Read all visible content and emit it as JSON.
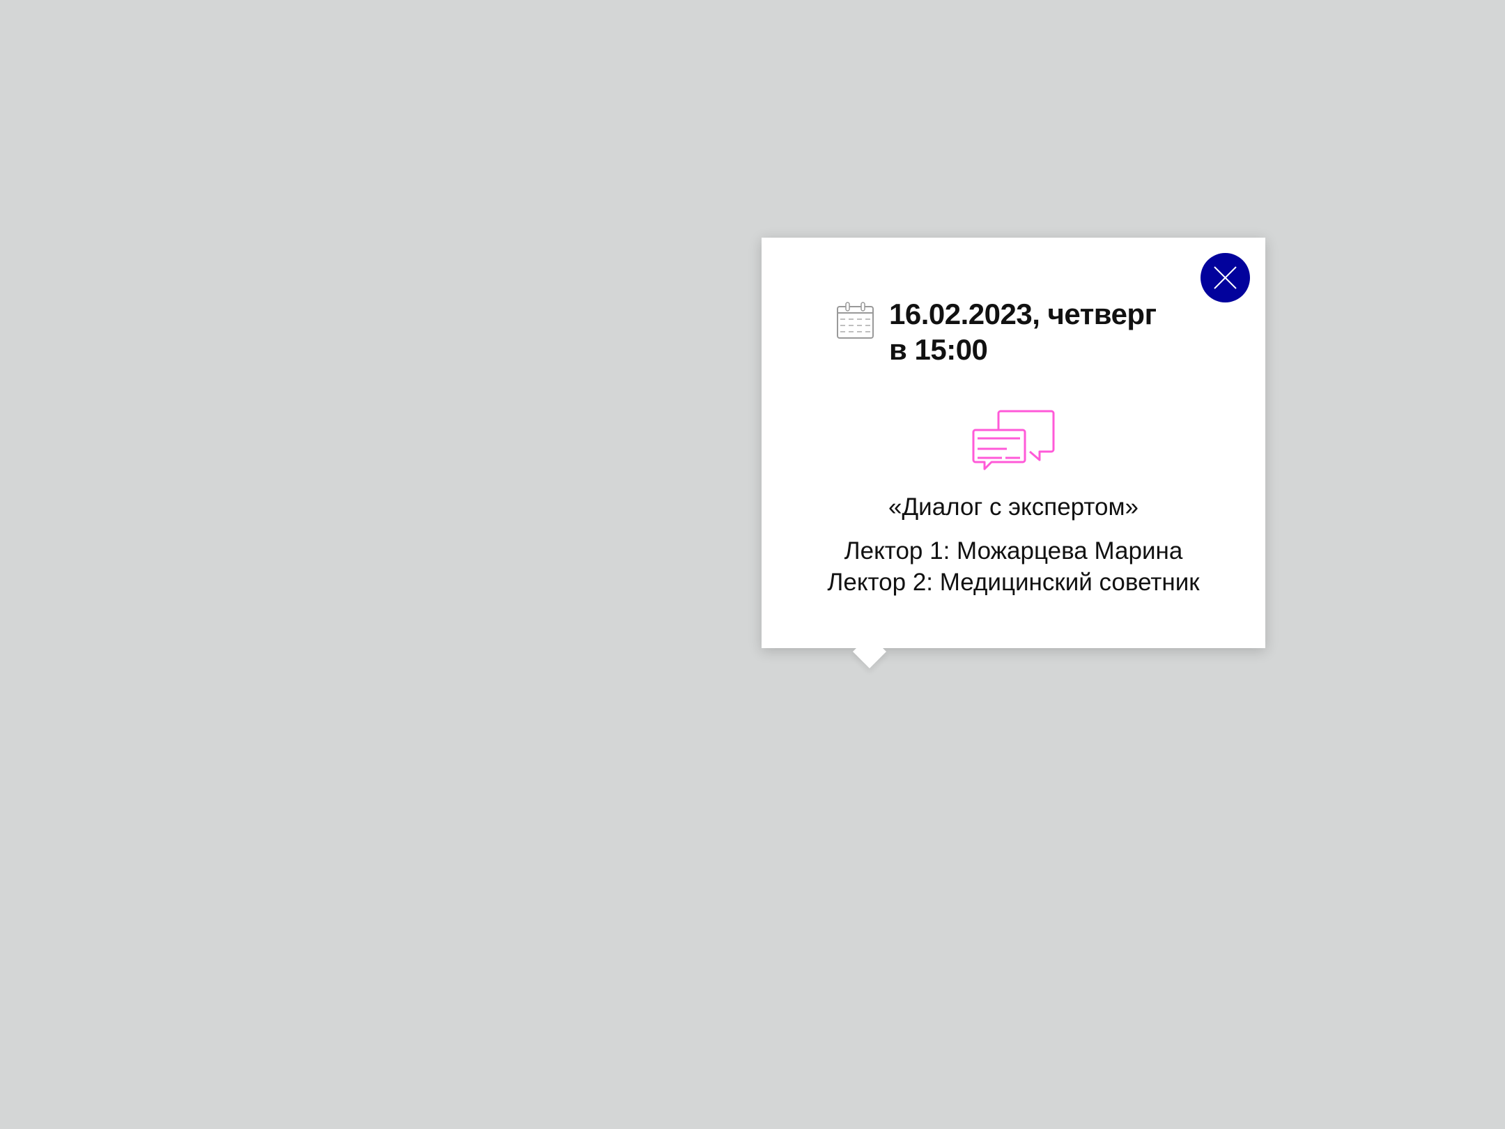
{
  "popup": {
    "date_line": "16.02.2023, четверг",
    "time_line": "в 15:00",
    "event_title": "«Диалог с экспертом»",
    "lecturers": [
      "Лектор 1: Можарцева Марина",
      "Лектор 2: Медицинский советник"
    ],
    "icons": {
      "calendar": "calendar-icon",
      "chat": "chat-bubbles-icon",
      "close": "close-icon"
    },
    "colors": {
      "close_bg": "#02029c",
      "chat_icon": "#ff5ad8",
      "background": "#d4d6d6"
    }
  }
}
